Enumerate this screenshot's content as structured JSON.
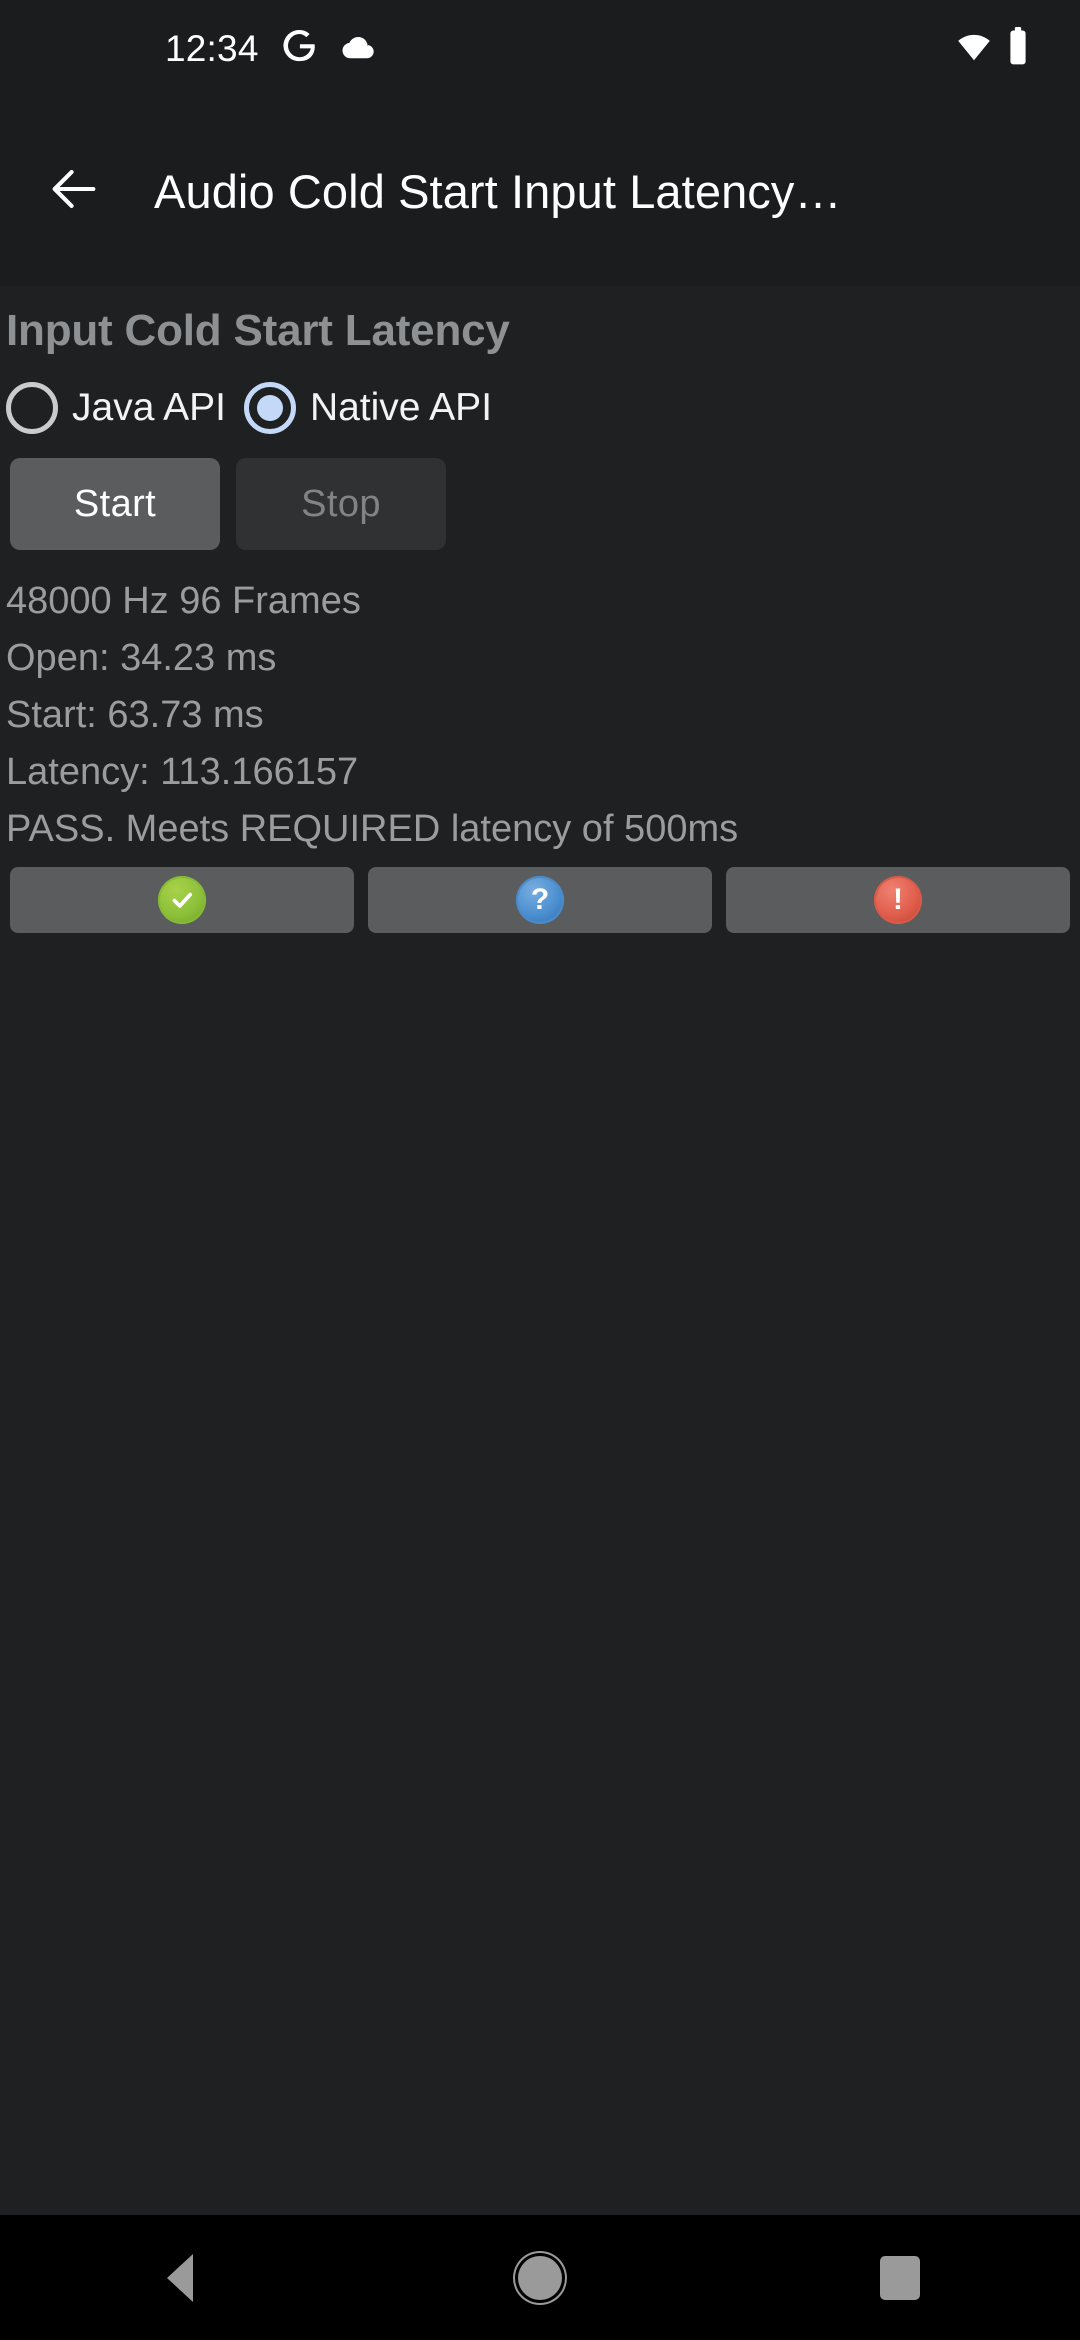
{
  "status_bar": {
    "clock": "12:34",
    "icons": [
      "google-icon",
      "cloud-icon"
    ],
    "right_icons": [
      "wifi-icon",
      "battery-icon"
    ]
  },
  "app_bar": {
    "back_icon": "arrow-back-icon",
    "title": "Audio Cold Start Input Latency…"
  },
  "content": {
    "section_title": "Input Cold Start Latency",
    "radio_group": {
      "name": "api-selection",
      "options": [
        {
          "id": "java-api",
          "label": "Java API",
          "selected": false
        },
        {
          "id": "native-api",
          "label": "Native API",
          "selected": true
        }
      ]
    },
    "buttons": {
      "start": {
        "label": "Start",
        "enabled": true
      },
      "stop": {
        "label": "Stop",
        "enabled": false
      }
    },
    "result_lines": [
      "48000 Hz 96 Frames",
      "Open: 34.23 ms",
      "Start: 63.73 ms",
      "Latency: 113.166157",
      "PASS. Meets REQUIRED latency of 500ms"
    ],
    "icon_buttons": [
      {
        "id": "pass",
        "icon": "check-circle-icon",
        "glyph": "✔",
        "color": "#8dc03a"
      },
      {
        "id": "info",
        "icon": "question-circle-icon",
        "glyph": "?",
        "color": "#4b8fd0"
      },
      {
        "id": "fail",
        "icon": "alert-circle-icon",
        "glyph": "!",
        "color": "#e15d4c"
      }
    ]
  },
  "nav_bar": {
    "back": "navigation-back-icon",
    "home": "navigation-home-icon",
    "recents": "navigation-recents-icon"
  },
  "colors": {
    "app_background": "#1f2022",
    "bar_background": "#1b1c1e",
    "nav_background": "#000000",
    "accent_radio": "#c3d9f7",
    "muted_text": "#9a9d9f",
    "pass_green": "#8dc03a",
    "info_blue": "#4b8fd0",
    "fail_red": "#e15d4c"
  }
}
